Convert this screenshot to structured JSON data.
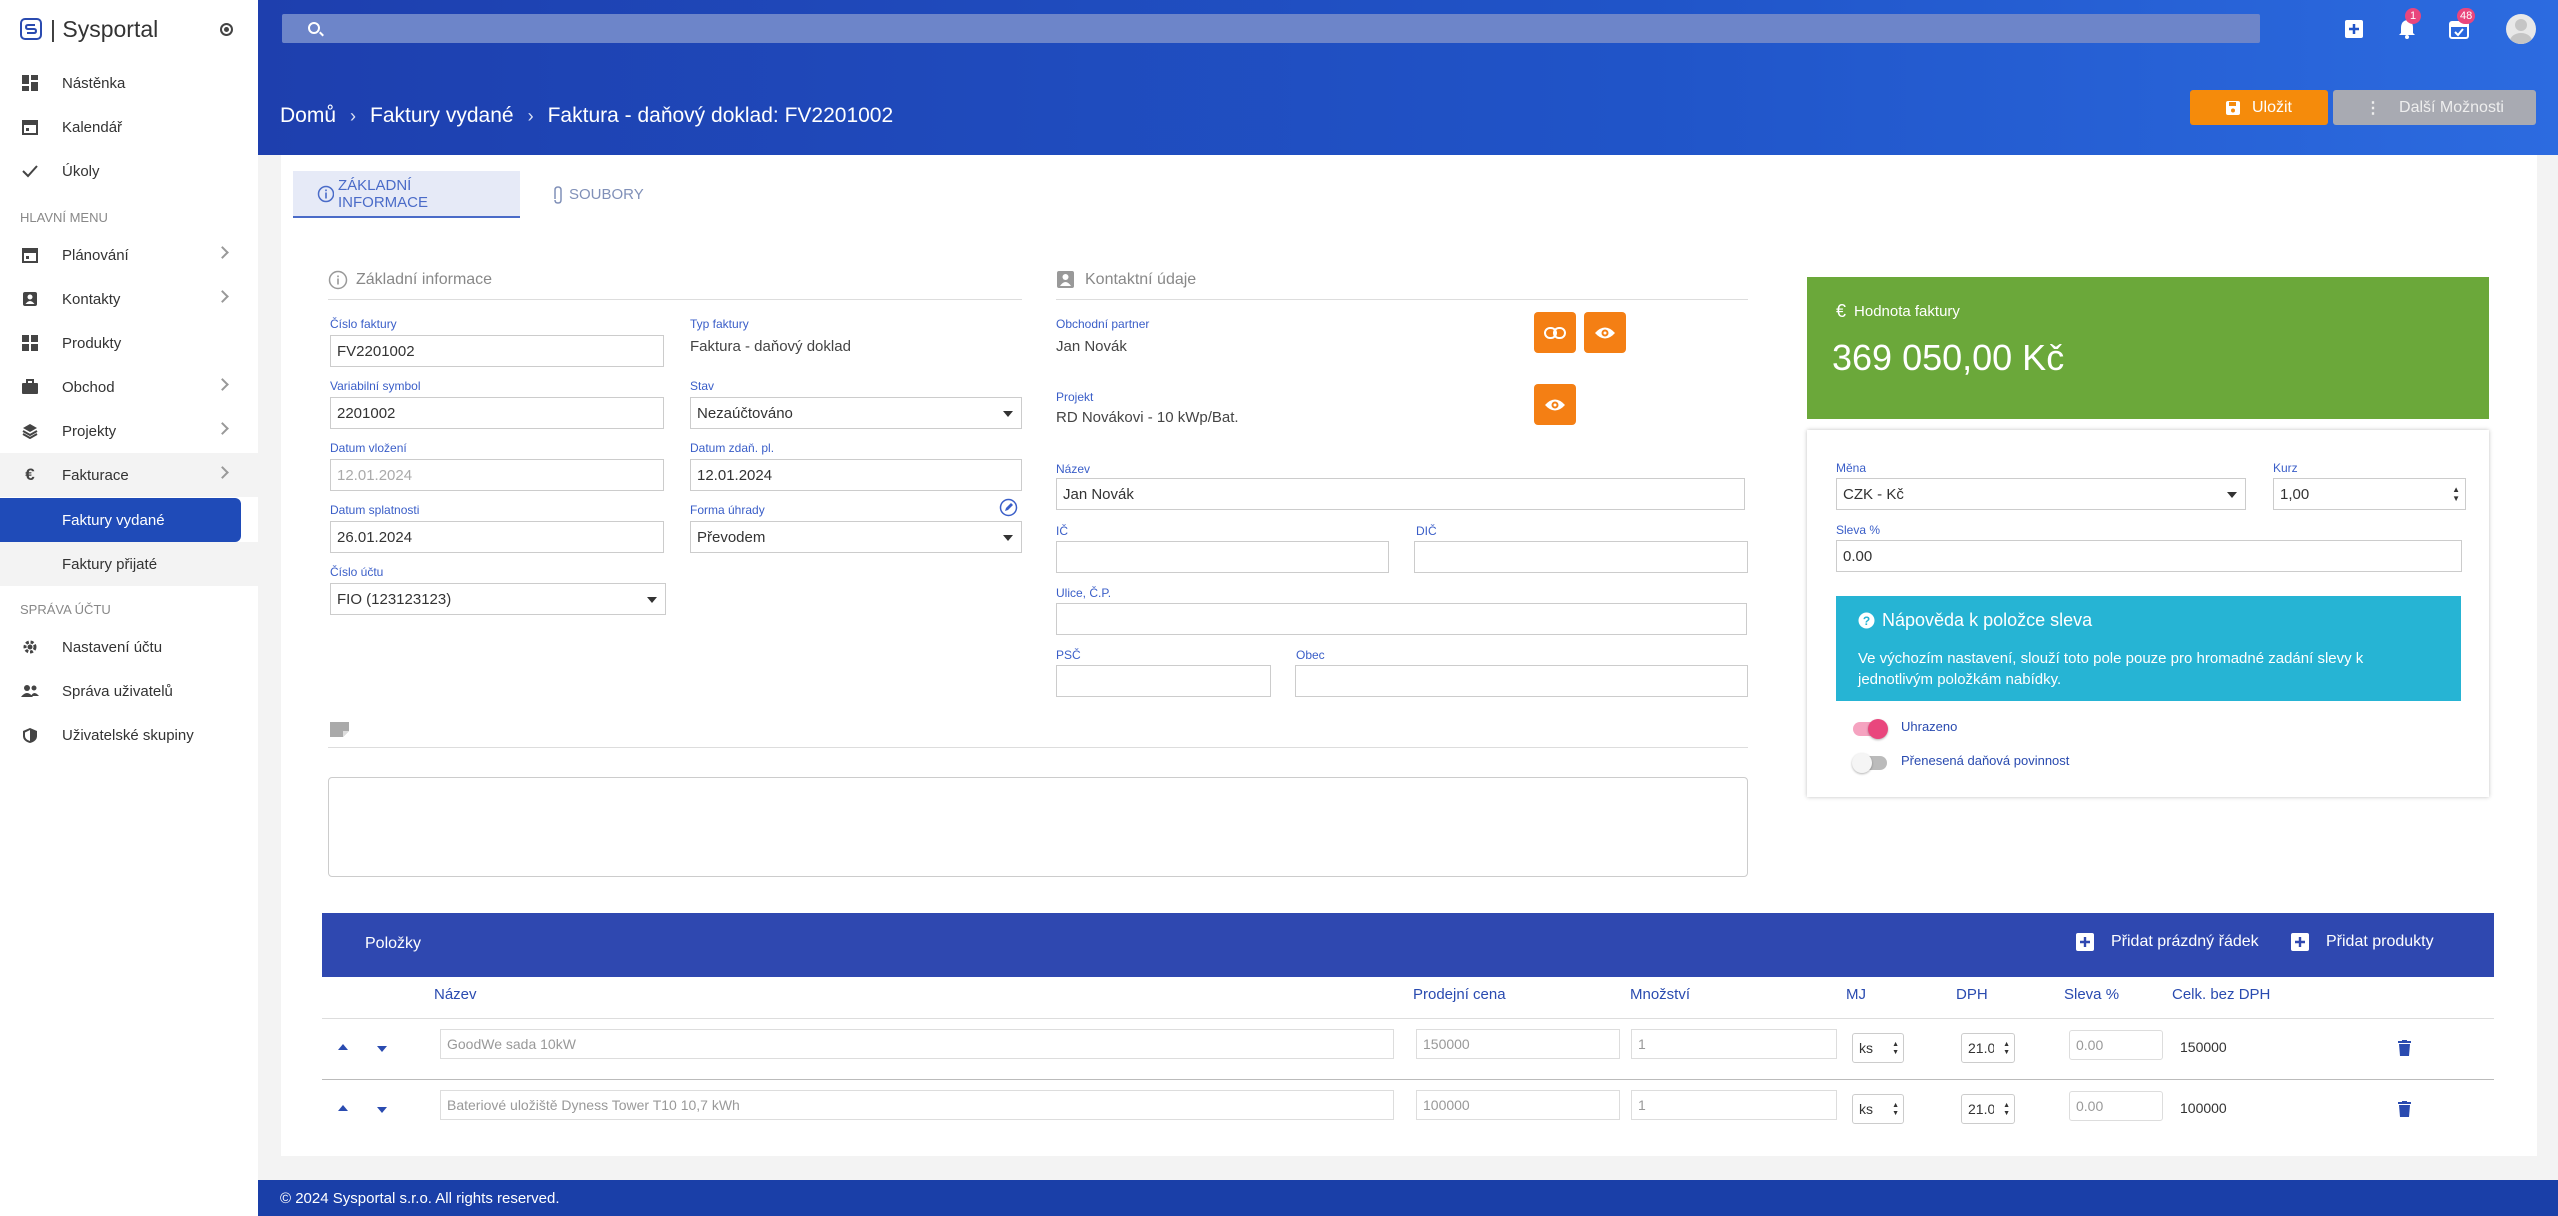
{
  "app": {
    "name": "| Sysportal"
  },
  "sidebar": {
    "top_items": [
      {
        "label": "Nástěnka"
      },
      {
        "label": "Kalendář"
      },
      {
        "label": "Úkoly"
      }
    ],
    "main_menu_header": "HLAVNÍ MENU",
    "main_items": [
      {
        "label": "Plánování"
      },
      {
        "label": "Kontakty"
      },
      {
        "label": "Produkty"
      },
      {
        "label": "Obchod"
      },
      {
        "label": "Projekty"
      },
      {
        "label": "Fakturace"
      }
    ],
    "sub_items": [
      {
        "label": "Faktury vydané",
        "active": true
      },
      {
        "label": "Faktury přijaté",
        "active": false
      }
    ],
    "account_header": "SPRÁVA ÚČTU",
    "account_items": [
      {
        "label": "Nastavení účtu"
      },
      {
        "label": "Správa uživatelů"
      },
      {
        "label": "Uživatelské skupiny"
      }
    ]
  },
  "topbar": {
    "search_placeholder": "",
    "notifications_count": "1",
    "calendar_count": "48"
  },
  "breadcrumb": [
    "Domů",
    "Faktury vydané",
    "Faktura - daňový doklad: FV2201002"
  ],
  "actions": {
    "save_label": "Uložit",
    "more_label": "Další Možnosti"
  },
  "tabs": [
    {
      "label": "ZÁKLADNÍ INFORMACE",
      "active": true
    },
    {
      "label": "SOUBORY",
      "active": false
    }
  ],
  "basic": {
    "section_title": "Základní informace",
    "invoice_number_label": "Číslo faktury",
    "invoice_number": "FV2201002",
    "invoice_type_label": "Typ faktury",
    "invoice_type": "Faktura - daňový doklad",
    "variable_symbol_label": "Variabilní symbol",
    "variable_symbol": "2201002",
    "status_label": "Stav",
    "status": "Nezaúčtováno",
    "created_label": "Datum vložení",
    "created": "12.01.2024",
    "tax_date_label": "Datum zdaň. pl.",
    "tax_date": "12.01.2024",
    "due_label": "Datum splatnosti",
    "due": "26.01.2024",
    "payment_label": "Forma úhrady",
    "payment": "Převodem",
    "account_label": "Číslo účtu",
    "account": "FIO (123123123)"
  },
  "contact": {
    "section_title": "Kontaktní údaje",
    "partner_label": "Obchodní partner",
    "partner": "Jan Novák",
    "project_label": "Projekt",
    "project": "RD Novákovi - 10 kWp/Bat.",
    "name_label": "Název",
    "name": "Jan Novák",
    "ic_label": "IČ",
    "ic": "",
    "dic_label": "DIČ",
    "dic": "",
    "street_label": "Ulice, Č.P.",
    "street": "",
    "zip_label": "PSČ",
    "zip": "",
    "city_label": "Obec",
    "city": ""
  },
  "value": {
    "title": "Hodnota faktury",
    "amount": "369 050,00 Kč",
    "color": "#6ba83a"
  },
  "settings": {
    "currency_label": "Měna",
    "currency": "CZK - Kč",
    "rate_label": "Kurz",
    "rate": "1,00",
    "discount_label": "Sleva %",
    "discount": "0.00",
    "help_title": "Nápověda k položce sleva",
    "help_text": "Ve výchozím nastavení, slouží toto pole pouze pro hromadné zadání slevy k jednotlivým položkám nabídky.",
    "paid_label": "Uhrazeno",
    "paid": true,
    "reverse_charge_label": "Přenesená daňová povinnost",
    "reverse_charge": false
  },
  "items": {
    "title": "Položky",
    "add_empty_label": "Přidat prázdný řádek",
    "add_products_label": "Přidat produkty",
    "columns": [
      "Název",
      "Prodejní cena",
      "Množství",
      "MJ",
      "DPH",
      "Sleva %",
      "Celk. bez DPH"
    ],
    "rows": [
      {
        "name": "GoodWe sada 10kW",
        "price": "150000",
        "qty": "1",
        "unit": "ks",
        "vat": "21.0",
        "discount": "0.00",
        "total": "150000"
      },
      {
        "name": "Bateriové uložiště Dyness Tower T10 10,7 kWh",
        "price": "100000",
        "qty": "1",
        "unit": "ks",
        "vat": "21.0",
        "discount": "0.00",
        "total": "100000"
      }
    ]
  },
  "footer": {
    "text": "© 2024 Sysportal s.r.o. All rights reserved."
  },
  "colors": {
    "primary": "#2f48b0",
    "accent": "#f47f14",
    "success": "#6ba83a",
    "info": "#26b4d4",
    "toggle_on": "#e9467d"
  }
}
